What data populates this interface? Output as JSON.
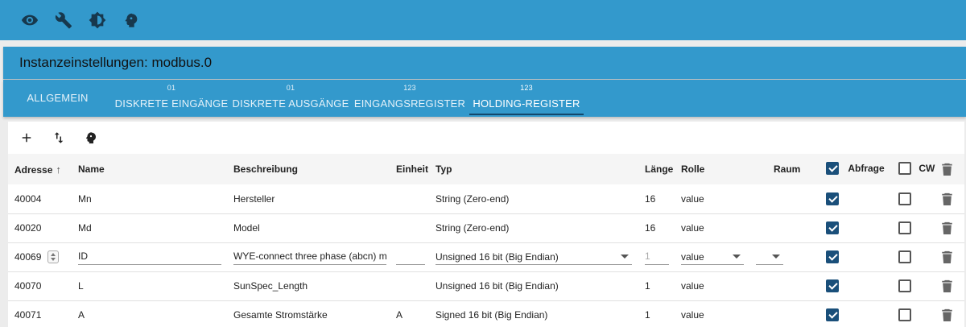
{
  "topbar": {
    "icons": [
      "eye-icon",
      "wrench-icon",
      "brightness-icon",
      "expert-head-icon"
    ]
  },
  "panel": {
    "title": "Instanzeinstellungen: modbus.0"
  },
  "tabs": [
    {
      "icon_label": "",
      "label": "ALLGEMEIN"
    },
    {
      "icon_label": "01",
      "label": "DISKRETE EINGÄNGE"
    },
    {
      "icon_label": "01",
      "label": "DISKRETE AUSGÄNGE"
    },
    {
      "icon_label": "123",
      "label": "EINGANGSREGISTER"
    },
    {
      "icon_label": "123",
      "label": "HOLDING-REGISTER"
    }
  ],
  "active_tab": "HOLDING-REGISTER",
  "toolbar": {
    "icons": [
      "add-icon",
      "import-export-icon",
      "expert-head-icon"
    ]
  },
  "table": {
    "headers": {
      "address": "Adresse",
      "name": "Name",
      "description": "Beschreibung",
      "unit": "Einheit",
      "type": "Typ",
      "length": "Länge",
      "role": "Rolle",
      "room": "Raum",
      "poll": "Abfrage",
      "cw": "CW"
    },
    "header_poll_checked": true,
    "header_cw_checked": false,
    "rows": [
      {
        "address": "40004",
        "name": "Mn",
        "description": "Hersteller",
        "unit": "",
        "type": "String (Zero-end)",
        "length": "16",
        "role": "value",
        "room": "",
        "poll": true,
        "cw": false
      },
      {
        "address": "40020",
        "name": "Md",
        "description": "Model",
        "unit": "",
        "type": "String (Zero-end)",
        "length": "16",
        "role": "value",
        "room": "",
        "poll": true,
        "cw": false
      },
      {
        "address": "40069",
        "name": "ID",
        "description": "WYE-connect three phase (abcn) mete",
        "unit": "",
        "type": "Unsigned 16 bit (Big Endian)",
        "length": "1",
        "role": "value",
        "room": "",
        "poll": true,
        "cw": false,
        "editing": true
      },
      {
        "address": "40070",
        "name": "L",
        "description": "SunSpec_Length",
        "unit": "",
        "type": "Unsigned 16 bit (Big Endian)",
        "length": "1",
        "role": "value",
        "room": "",
        "poll": true,
        "cw": false
      },
      {
        "address": "40071",
        "name": "A",
        "description": "Gesamte Stromstärke",
        "unit": "A",
        "type": "Signed 16 bit (Big Endian)",
        "length": "1",
        "role": "value",
        "room": "",
        "poll": true,
        "cw": false
      }
    ]
  },
  "colors": {
    "header_blue": "#3399cc",
    "checkbox_blue": "#1a4f7a",
    "tab_indicator": "#13476b"
  }
}
